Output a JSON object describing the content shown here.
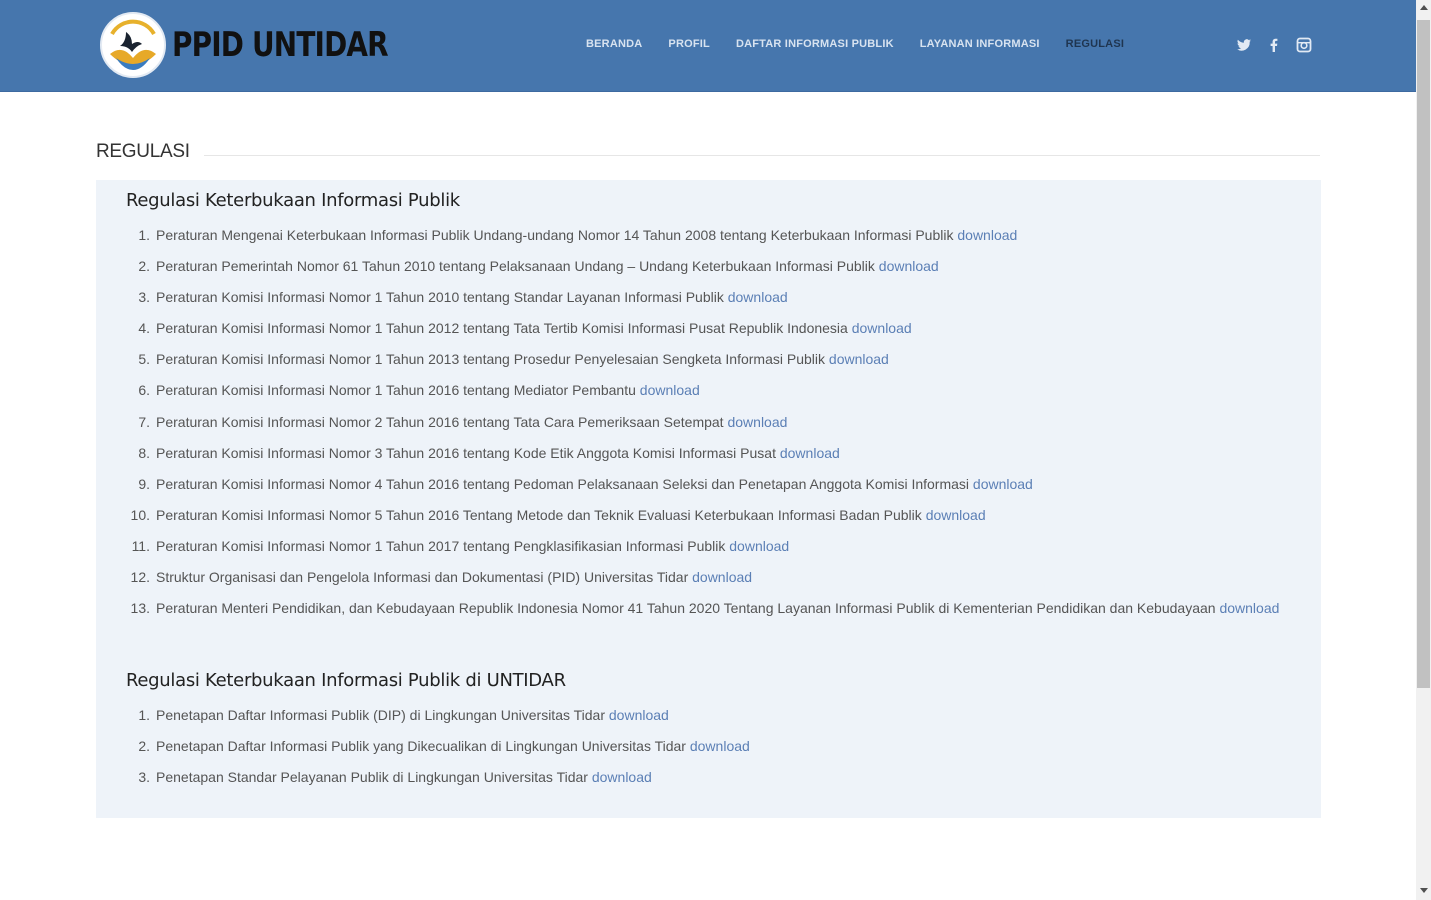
{
  "header": {
    "logo_text": "PPID UNTIDAR",
    "nav": [
      {
        "label": "BERANDA",
        "active": false
      },
      {
        "label": "PROFIL",
        "active": false
      },
      {
        "label": "DAFTAR INFORMASI PUBLIK",
        "active": false
      },
      {
        "label": "LAYANAN INFORMASI",
        "active": false
      },
      {
        "label": "REGULASI",
        "active": true
      }
    ],
    "social": [
      "twitter-icon",
      "facebook-icon",
      "instagram-icon"
    ],
    "colors": {
      "bar": "#4676ad",
      "nav_text": "#d8e3f0",
      "nav_active": "#1f3550"
    }
  },
  "page_title": "REGULASI",
  "sections": [
    {
      "title": "Regulasi Keterbukaan Informasi Publik",
      "items": [
        {
          "num": "1.",
          "text": "Peraturan Mengenai Keterbukaan Informasi Publik Undang-undang Nomor 14 Tahun 2008 tentang Keterbukaan Informasi Publik",
          "link": "download"
        },
        {
          "num": "2.",
          "text": "Peraturan Pemerintah Nomor 61 Tahun 2010 tentang Pelaksanaan Undang – Undang Keterbukaan Informasi Publik",
          "link": "download"
        },
        {
          "num": "3.",
          "text": "Peraturan Komisi Informasi Nomor 1 Tahun 2010 tentang Standar Layanan Informasi Publik",
          "link": "download"
        },
        {
          "num": "4.",
          "text": "Peraturan Komisi Informasi Nomor 1 Tahun 2012 tentang Tata Tertib Komisi Informasi Pusat Republik Indonesia",
          "link": "download"
        },
        {
          "num": "5.",
          "text": "Peraturan Komisi Informasi Nomor 1 Tahun 2013 tentang Prosedur Penyelesaian Sengketa Informasi Publik",
          "link": "download"
        },
        {
          "num": "6.",
          "text": "Peraturan Komisi Informasi Nomor 1 Tahun 2016 tentang Mediator Pembantu",
          "link": "download"
        },
        {
          "num": "7.",
          "text": "Peraturan Komisi Informasi Nomor 2 Tahun 2016 tentang Tata Cara Pemeriksaan Setempat",
          "link": "download"
        },
        {
          "num": "8.",
          "text": "Peraturan Komisi Informasi Nomor 3 Tahun 2016 tentang Kode Etik Anggota Komisi Informasi Pusat",
          "link": "download"
        },
        {
          "num": "9.",
          "text": "Peraturan Komisi Informasi Nomor 4 Tahun 2016 tentang Pedoman Pelaksanaan Seleksi dan Penetapan Anggota Komisi Informasi",
          "link": "download"
        },
        {
          "num": "10.",
          "text": "Peraturan Komisi Informasi Nomor 5 Tahun 2016 Tentang Metode dan Teknik Evaluasi Keterbukaan Informasi Badan Publik",
          "link": "download"
        },
        {
          "num": "11.",
          "text": "Peraturan Komisi Informasi Nomor 1 Tahun 2017 tentang Pengklasifikasian Informasi Publik",
          "link": "download"
        },
        {
          "num": "12.",
          "text": "Struktur Organisasi dan Pengelola Informasi dan Dokumentasi (PID) Universitas Tidar",
          "link": "download"
        },
        {
          "num": "13.",
          "text": "Peraturan Menteri Pendidikan, dan Kebudayaan Republik Indonesia Nomor 41 Tahun 2020 Tentang Layanan Informasi Publik  di Kementerian Pendidikan dan Kebudayaan",
          "link": "download"
        }
      ]
    },
    {
      "title": "Regulasi Keterbukaan Informasi Publik di UNTIDAR",
      "items": [
        {
          "num": "1.",
          "text": "Penetapan Daftar Informasi Publik (DIP) di Lingkungan Universitas Tidar",
          "link": "download"
        },
        {
          "num": "2.",
          "text": "Penetapan Daftar Informasi Publik yang Dikecualikan di Lingkungan Universitas Tidar",
          "link": "download"
        },
        {
          "num": "3.",
          "text": "Penetapan Standar Pelayanan Publik di Lingkungan Universitas Tidar",
          "link": "download"
        }
      ]
    }
  ]
}
